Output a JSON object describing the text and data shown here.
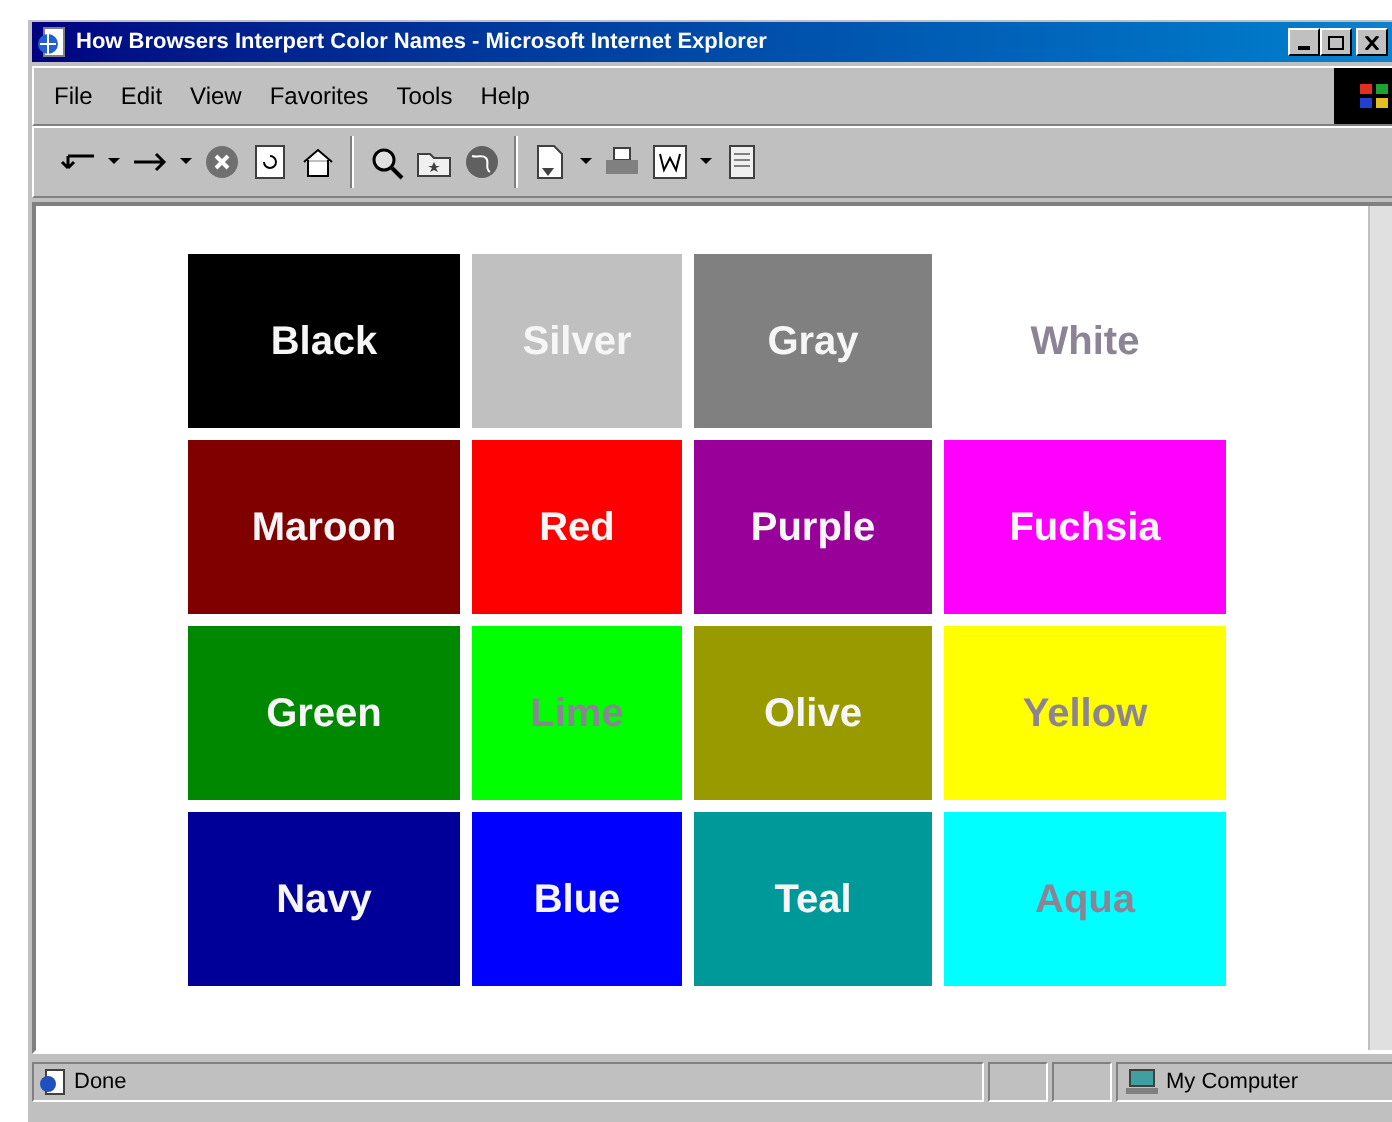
{
  "window": {
    "title": "How Browsers Interpert Color Names - Microsoft Internet Explorer"
  },
  "menu": [
    "File",
    "Edit",
    "View",
    "Favorites",
    "Tools",
    "Help"
  ],
  "swatches": [
    [
      {
        "label": "Black",
        "color": "#000000",
        "kind": "light"
      },
      {
        "label": "Silver",
        "color": "#c0c0c0",
        "kind": "light"
      },
      {
        "label": "Gray",
        "color": "#808080",
        "kind": "light"
      },
      {
        "label": "White",
        "color": "#ffffff",
        "kind": "dim"
      }
    ],
    [
      {
        "label": "Maroon",
        "color": "#800000",
        "kind": "light"
      },
      {
        "label": "Red",
        "color": "#ff0000",
        "kind": "light"
      },
      {
        "label": "Purple",
        "color": "#990099",
        "kind": "light"
      },
      {
        "label": "Fuchsia",
        "color": "#ff00ff",
        "kind": "light"
      }
    ],
    [
      {
        "label": "Green",
        "color": "#008800",
        "kind": "light"
      },
      {
        "label": "Lime",
        "color": "#00ff00",
        "kind": "dim"
      },
      {
        "label": "Olive",
        "color": "#999900",
        "kind": "light"
      },
      {
        "label": "Yellow",
        "color": "#ffff00",
        "kind": "dim"
      }
    ],
    [
      {
        "label": "Navy",
        "color": "#000099",
        "kind": "light"
      },
      {
        "label": "Blue",
        "color": "#0000ff",
        "kind": "light"
      },
      {
        "label": "Teal",
        "color": "#009999",
        "kind": "light"
      },
      {
        "label": "Aqua",
        "color": "#00ffff",
        "kind": "dim"
      }
    ]
  ],
  "status_bar": {
    "text": "Done",
    "zone": "My Computer"
  }
}
